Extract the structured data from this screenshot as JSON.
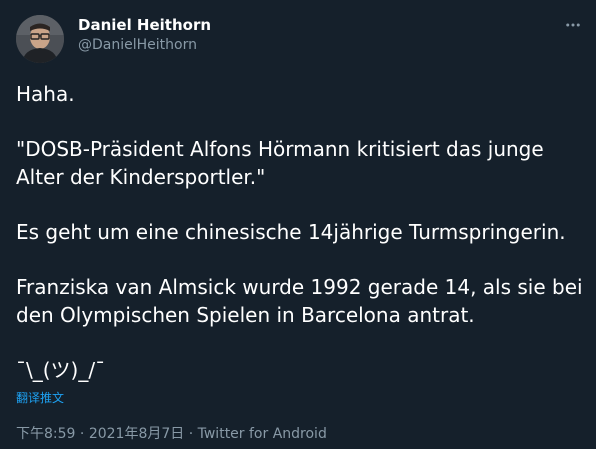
{
  "author": {
    "display_name": "Daniel Heithorn",
    "handle": "@DanielHeithorn"
  },
  "tweet": {
    "paragraphs": [
      "Haha.",
      "\"DOSB-Präsident Alfons Hörmann kritisiert das junge Alter der Kindersportler.\"",
      "Es geht um eine chinesische 14jährige Turmspringerin.",
      "Franziska van Almsick wurde 1992 gerade 14, als sie bei den Olympischen Spielen in Barcelona antrat.",
      "¯\\_(ツ)_/¯"
    ],
    "translate_label": "翻译推文"
  },
  "meta": {
    "time": "下午8:59",
    "separator": " · ",
    "date": "2021年8月7日",
    "source": "Twitter for Android"
  },
  "colors": {
    "background": "#15202b",
    "text": "#ffffff",
    "secondary": "#8899a6",
    "accent": "#1da1f2"
  },
  "icons": {
    "more": "more-horizontal-icon",
    "avatar": "user-avatar"
  }
}
